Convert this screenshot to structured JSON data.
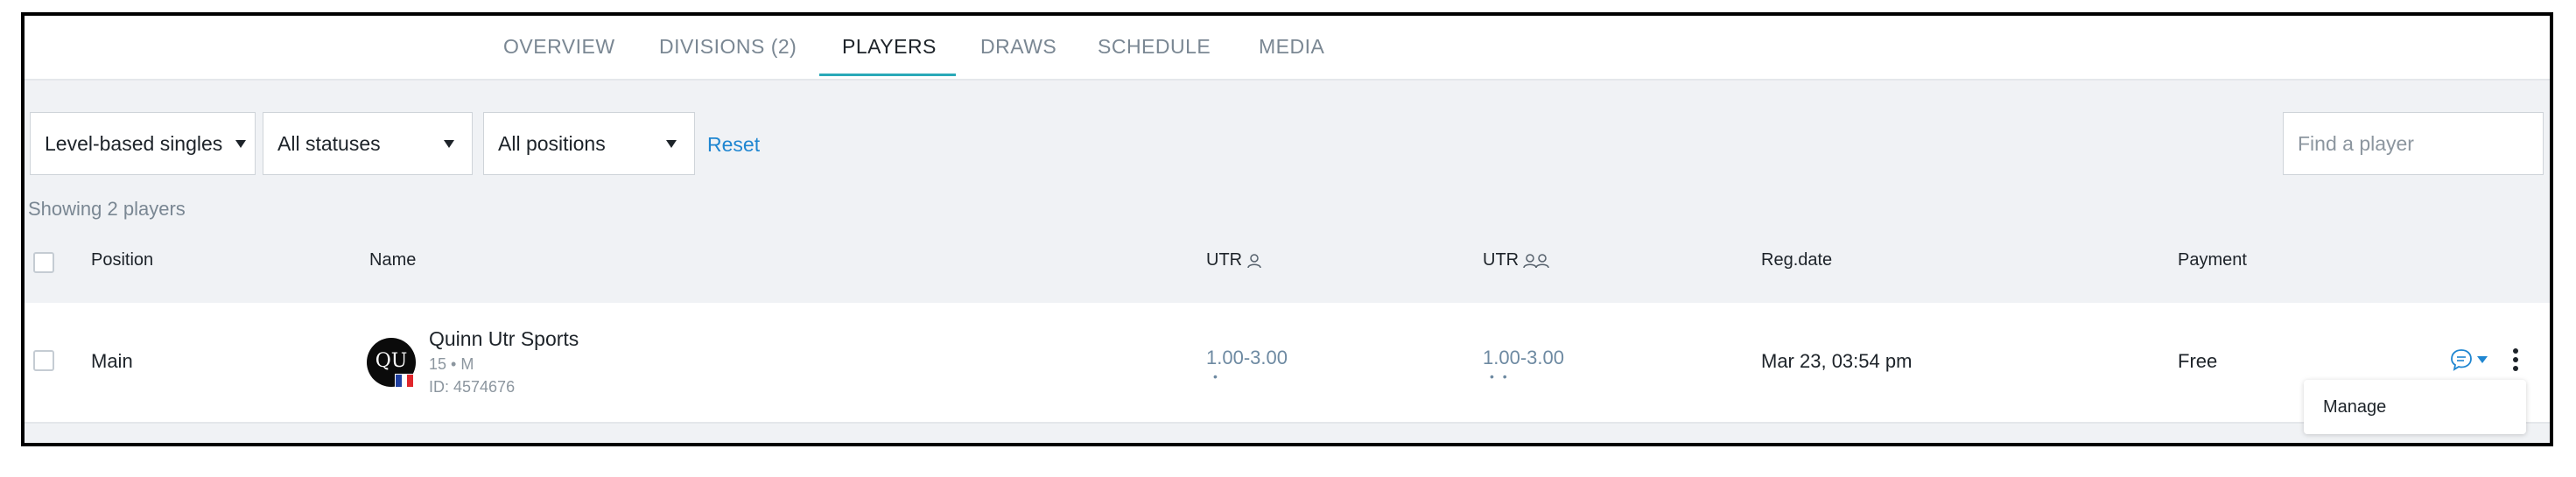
{
  "tabs": [
    {
      "label": "OVERVIEW"
    },
    {
      "label": "DIVISIONS (2)"
    },
    {
      "label": "PLAYERS"
    },
    {
      "label": "DRAWS"
    },
    {
      "label": "SCHEDULE"
    },
    {
      "label": "MEDIA"
    }
  ],
  "active_tab": "PLAYERS",
  "filters": {
    "division": "Level-based singles",
    "status": "All statuses",
    "position": "All positions",
    "reset_label": "Reset",
    "search_placeholder": "Find a player"
  },
  "showing_text": "Showing 2 players",
  "columns": {
    "position": "Position",
    "name": "Name",
    "utr_singles": "UTR",
    "utr_doubles": "UTR",
    "reg_date": "Reg.date",
    "payment": "Payment"
  },
  "rows": [
    {
      "position": "Main",
      "avatar_initials": "QU",
      "name": "Quinn Utr Sports",
      "details": "15 • M",
      "id_text": "ID: 4574676",
      "utr_singles": "1.00-3.00",
      "utr_singles_dots": "•",
      "utr_doubles": "1.00-3.00",
      "utr_doubles_dots": "• •",
      "reg_date": "Mar 23, 03:54 pm",
      "payment": "Free"
    }
  ],
  "row_menu": {
    "manage_label": "Manage"
  },
  "colors": {
    "accent": "#2aa9b8",
    "link": "#1f86d1",
    "utr": "#6e8aa2",
    "chat_icon": "#1f86d1"
  },
  "icons": [
    "person-icon",
    "people-icon",
    "chat-icon",
    "caret-down-icon",
    "more-vertical-icon",
    "flag-icon"
  ]
}
